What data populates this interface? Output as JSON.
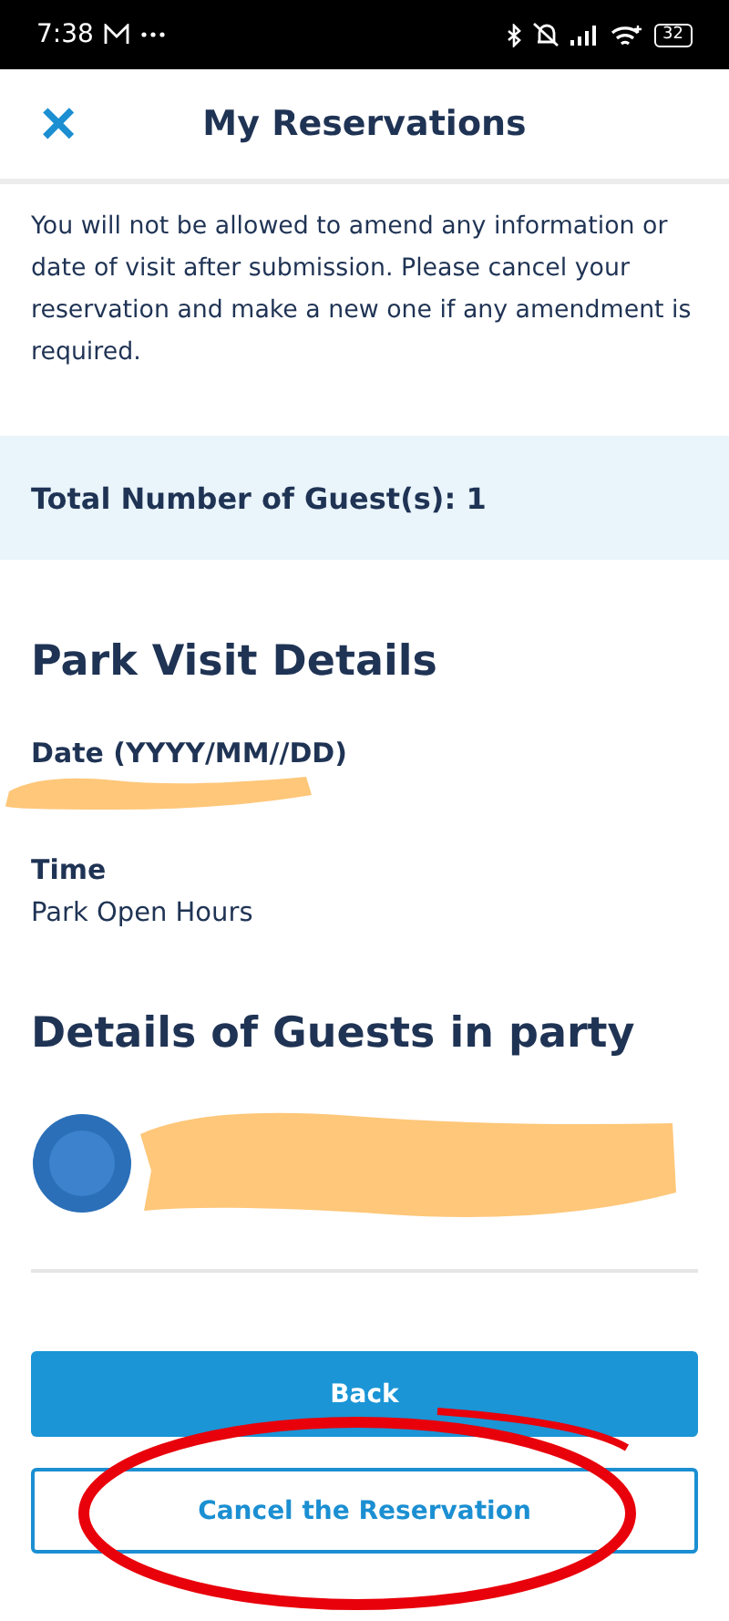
{
  "status_bar": {
    "time": "7:38",
    "battery": "32"
  },
  "header": {
    "close_icon": "×",
    "title": "My Reservations"
  },
  "notice": "You will not be allowed to amend any information or date of visit after submission. Please cancel your reservation and make a new one if any amendment is required.",
  "guest_total": "Total Number of Guest(s): 1",
  "visit_details": {
    "heading": "Park Visit Details",
    "fields": [
      {
        "label": "Date (YYYY/MM//DD)",
        "redacted": true
      },
      {
        "label": "Time",
        "value": "Park Open Hours"
      }
    ]
  },
  "guests": {
    "heading": "Details of Guests in party",
    "items": [
      {
        "redacted": true
      }
    ]
  },
  "buttons": [
    {
      "label": "Back",
      "kind": "primary"
    },
    {
      "label": "Cancel the Reservation",
      "kind": "outline"
    }
  ],
  "annotation": {
    "kind": "ellipse"
  }
}
